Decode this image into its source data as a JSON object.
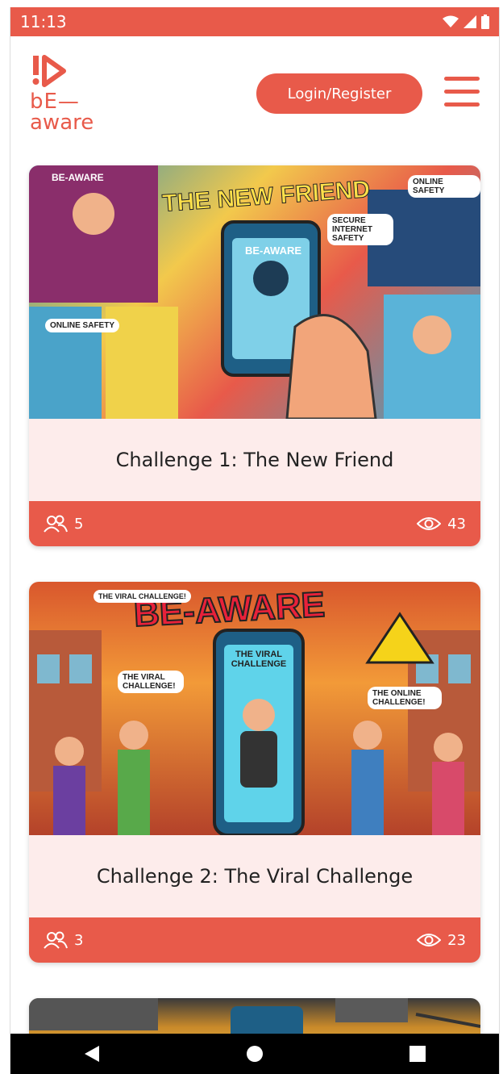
{
  "status_bar": {
    "time": "11:13"
  },
  "header": {
    "logo": {
      "line1": "bE—",
      "line2": "aware"
    },
    "login_label": "Login/Register"
  },
  "cards": [
    {
      "title": "Challenge 1: The New Friend",
      "participants": "5",
      "views": "43",
      "image_text": {
        "headline": "THE NEW FRIEND",
        "brand": "BE-AWARE",
        "phone_brand": "BE-AWARE",
        "bubble1": "ONLINE SAFETY",
        "bubble2": "SECURE INTERNET SAFETY",
        "bubble3": "ONLINE SAFETY"
      }
    },
    {
      "title": "Challenge 2: The Viral Challenge",
      "participants": "3",
      "views": "23",
      "image_text": {
        "headline": "BE-AWARE",
        "phone_title": "THE VIRAL CHALLENGE",
        "bubble1": "THE VIRAL CHALLENGE!",
        "bubble2": "THE VIRAL CHALLENGE!",
        "bubble3": "THE ONLINE CHALLENGE!"
      }
    }
  ],
  "colors": {
    "accent": "#e85a4a",
    "card_bg": "#fdeceb"
  }
}
